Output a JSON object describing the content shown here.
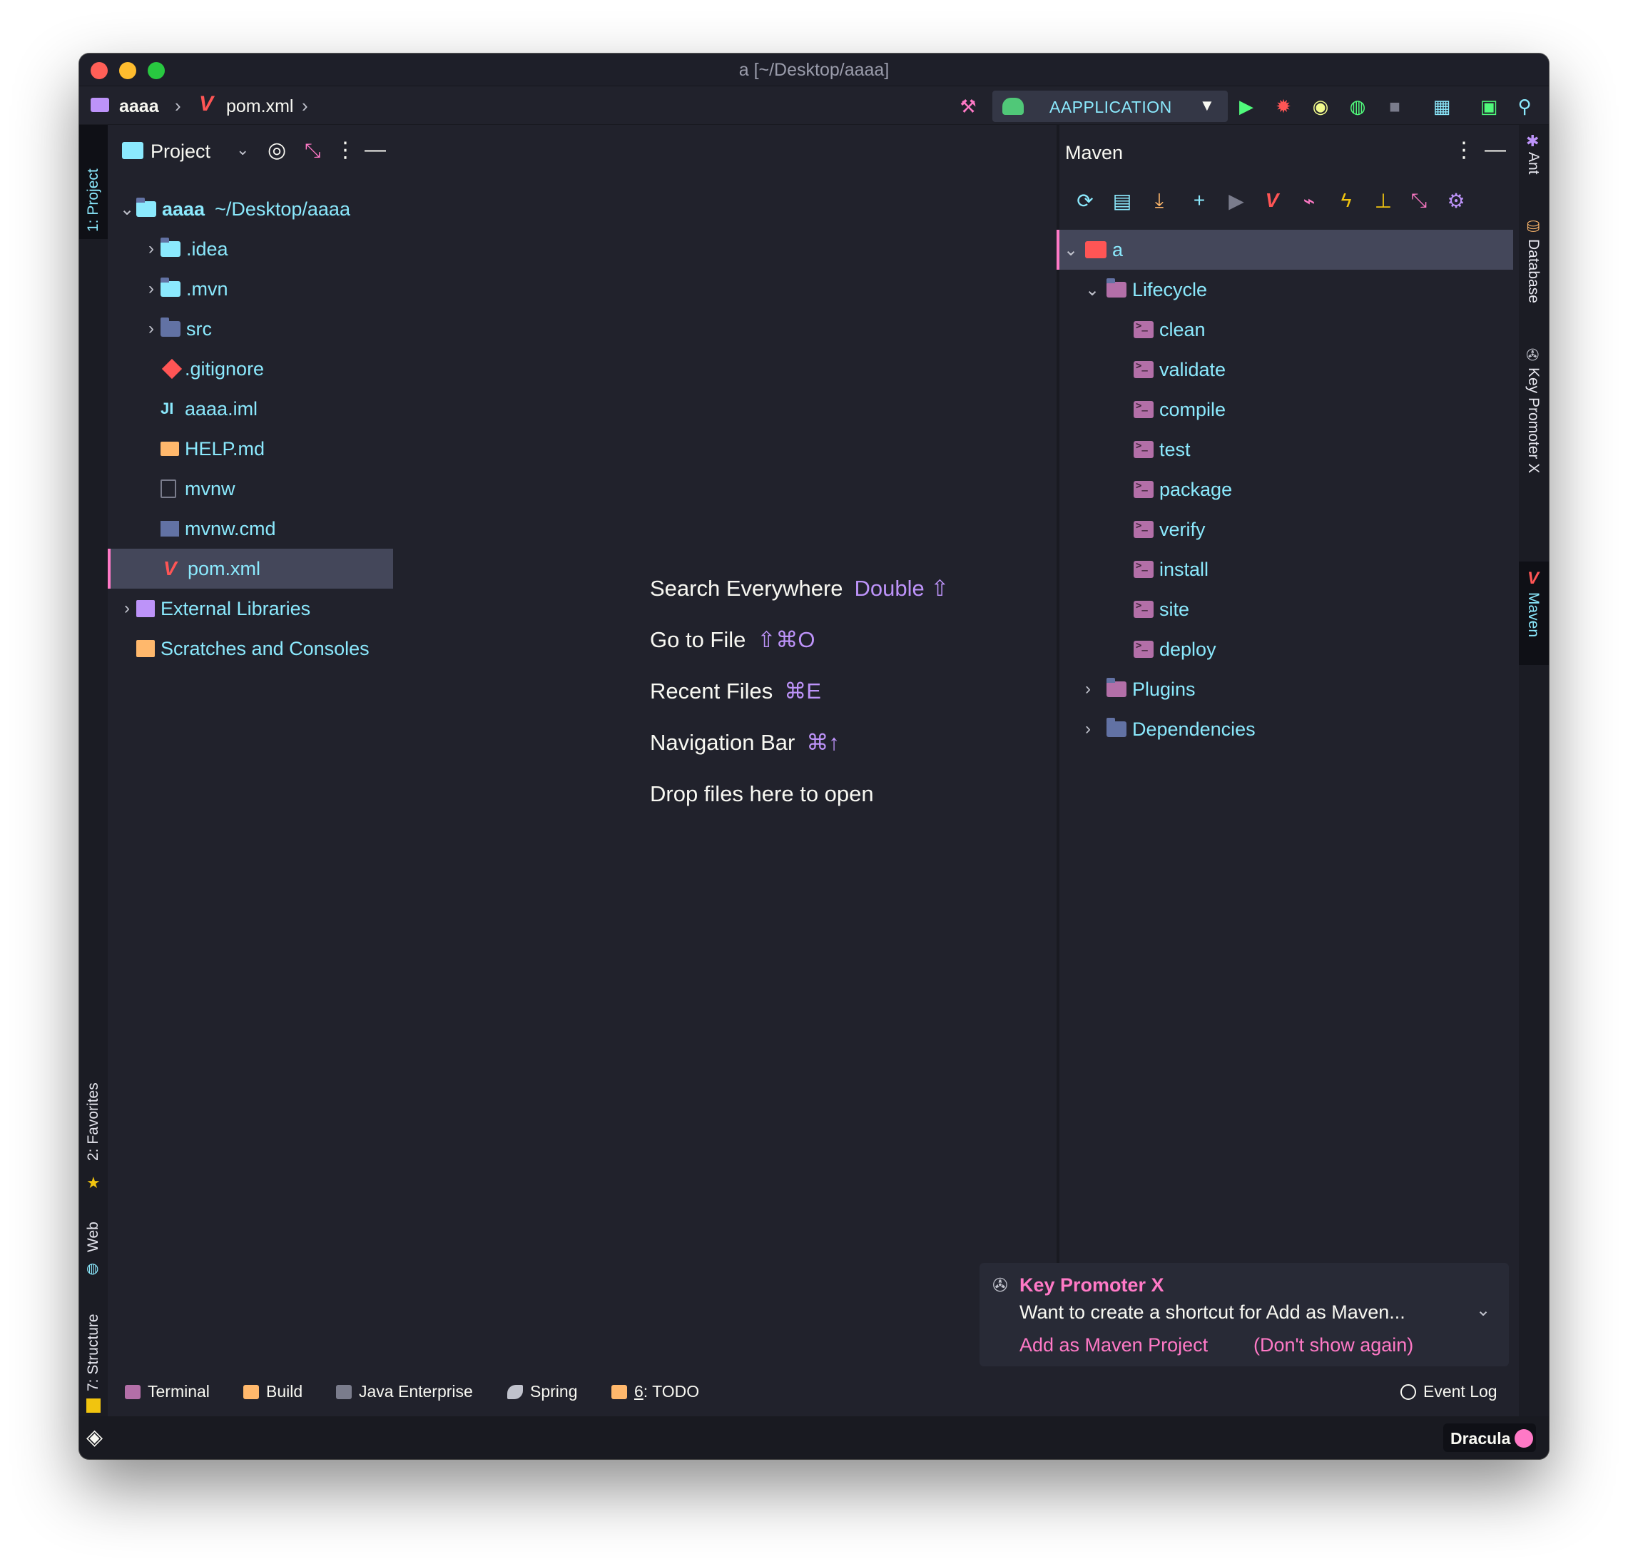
{
  "window": {
    "title": "a [~/Desktop/aaaa]"
  },
  "navbar": {
    "project": "aaaa",
    "file": "pom.xml",
    "run_config": "AAPPLICATION"
  },
  "left_stripe": {
    "project_tab": "1: Project",
    "favorites_tab": "2: Favorites",
    "web_tab": "Web",
    "structure_tab": "7: Structure"
  },
  "right_stripe": {
    "ant_tab": "Ant",
    "database_tab": "Database",
    "keypromoter_tab": "Key Promoter X",
    "maven_tab": "Maven"
  },
  "project_panel": {
    "title": "Project",
    "root_name": "aaaa",
    "root_path": "~/Desktop/aaaa",
    "items": [
      {
        "label": ".idea",
        "icon": "folder-idea-icon"
      },
      {
        "label": ".mvn",
        "icon": "folder-icon"
      },
      {
        "label": "src",
        "icon": "folder-src-icon"
      },
      {
        "label": ".gitignore",
        "icon": "git-file-icon"
      },
      {
        "label": "aaaa.iml",
        "icon": "iml-file-icon"
      },
      {
        "label": "HELP.md",
        "icon": "markdown-file-icon"
      },
      {
        "label": "mvnw",
        "icon": "text-file-icon"
      },
      {
        "label": "mvnw.cmd",
        "icon": "cmd-file-icon"
      },
      {
        "label": "pom.xml",
        "icon": "maven-file-icon"
      }
    ],
    "external_libraries": "External Libraries",
    "scratches": "Scratches and Consoles"
  },
  "editor_hints": [
    {
      "label": "Search Everywhere",
      "key": "Double ⇧"
    },
    {
      "label": "Go to File",
      "key": "⇧⌘O"
    },
    {
      "label": "Recent Files",
      "key": "⌘E"
    },
    {
      "label": "Navigation Bar",
      "key": "⌘↑"
    },
    {
      "label": "Drop files here to open",
      "key": ""
    }
  ],
  "maven_panel": {
    "title": "Maven",
    "root": "a",
    "lifecycle": "Lifecycle",
    "goals": [
      "clean",
      "validate",
      "compile",
      "test",
      "package",
      "verify",
      "install",
      "site",
      "deploy"
    ],
    "plugins": "Plugins",
    "dependencies": "Dependencies"
  },
  "notification": {
    "title": "Key Promoter X",
    "message": "Want to create a shortcut for Add as Maven...",
    "action1": "Add as Maven Project",
    "action2": "(Don't show again)"
  },
  "bottom_tools": {
    "terminal": "Terminal",
    "build": "Build",
    "java_enterprise": "Java Enterprise",
    "spring": "Spring",
    "todo_num": "6",
    "todo": ": TODO",
    "event_log": "Event Log"
  },
  "status": {
    "theme": "Dracula"
  },
  "colors": {
    "background": "#21222c",
    "accent_pink": "#ff79c6",
    "cyan": "#8be9fd",
    "purple": "#bd93f9",
    "selection": "#44475a"
  }
}
